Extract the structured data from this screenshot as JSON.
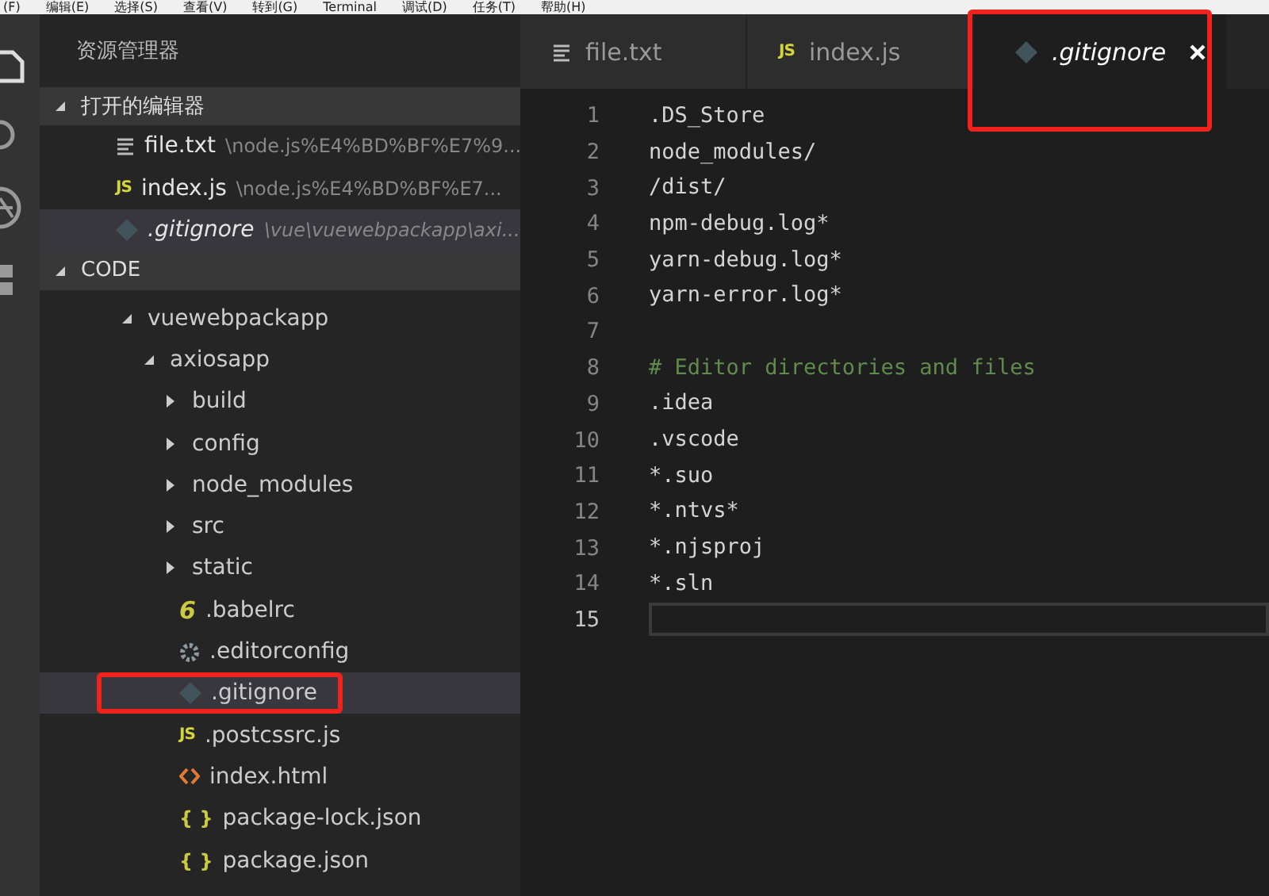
{
  "menu_bar": [
    "(F)",
    "编辑(E)",
    "选择(S)",
    "查看(V)",
    "转到(G)",
    "Terminal",
    "调试(D)",
    "任务(T)",
    "帮助(H)"
  ],
  "sidebar": {
    "title": "资源管理器",
    "open_editors": {
      "label": "打开的编辑器",
      "expanded": true,
      "items": [
        {
          "name": "file.txt",
          "path": "\\node.js%E4%BD%BF%E7%9...",
          "kind": "text",
          "preview": false,
          "selected": false
        },
        {
          "name": "index.js",
          "path": "\\node.js%E4%BD%BF%E7...",
          "kind": "js",
          "icon_text": "JS",
          "preview": false,
          "selected": false
        },
        {
          "name": ".gitignore",
          "path": "\\vue\\vuewebpackapp\\axi...",
          "kind": "git",
          "preview": true,
          "selected": true
        }
      ]
    },
    "folder": {
      "label": "CODE",
      "expanded": true,
      "tree": [
        {
          "name": "vuewebpackapp",
          "kind": "folder",
          "expanded": true,
          "selected": false,
          "annotated": false,
          "children": [
            {
              "name": "axiosapp",
              "kind": "folder",
              "expanded": true,
              "selected": false,
              "annotated": false,
              "children": [
                {
                  "name": "build",
                  "kind": "folder",
                  "expanded": false,
                  "selected": false,
                  "annotated": false
                },
                {
                  "name": "config",
                  "kind": "folder",
                  "expanded": false,
                  "selected": false,
                  "annotated": false
                },
                {
                  "name": "node_modules",
                  "kind": "folder",
                  "expanded": false,
                  "selected": false,
                  "annotated": false
                },
                {
                  "name": "src",
                  "kind": "folder",
                  "expanded": false,
                  "selected": false,
                  "annotated": false
                },
                {
                  "name": "static",
                  "kind": "folder",
                  "expanded": false,
                  "selected": false,
                  "annotated": false
                },
                {
                  "name": ".babelrc",
                  "kind": "babel",
                  "icon_text": "6",
                  "selected": false,
                  "annotated": false
                },
                {
                  "name": ".editorconfig",
                  "kind": "config",
                  "selected": false,
                  "annotated": false
                },
                {
                  "name": ".gitignore",
                  "kind": "git",
                  "selected": true,
                  "annotated": true
                },
                {
                  "name": ".postcssrc.js",
                  "kind": "js",
                  "icon_text": "JS",
                  "selected": false,
                  "annotated": false
                },
                {
                  "name": "index.html",
                  "kind": "html",
                  "selected": false,
                  "annotated": false
                },
                {
                  "name": "package-lock.json",
                  "kind": "json",
                  "icon_text": "{ }",
                  "selected": false,
                  "annotated": false
                },
                {
                  "name": "package.json",
                  "kind": "json",
                  "icon_text": "{ }",
                  "selected": false,
                  "annotated": false
                }
              ]
            }
          ]
        }
      ]
    }
  },
  "tabs": [
    {
      "label": "file.txt",
      "kind": "text",
      "selected": false,
      "preview": false,
      "annotated": false
    },
    {
      "label": "index.js",
      "kind": "js",
      "icon_text": "JS",
      "selected": false,
      "preview": false,
      "annotated": false
    },
    {
      "label": ".gitignore",
      "kind": "git",
      "selected": true,
      "preview": true,
      "annotated": true
    }
  ],
  "editor": {
    "lines": [
      {
        "number": "1",
        "text": ".DS_Store",
        "kind": "plain",
        "current": false
      },
      {
        "number": "2",
        "text": "node_modules/",
        "kind": "plain",
        "current": false
      },
      {
        "number": "3",
        "text": "/dist/",
        "kind": "plain",
        "current": false
      },
      {
        "number": "4",
        "text": "npm-debug.log*",
        "kind": "plain",
        "current": false
      },
      {
        "number": "5",
        "text": "yarn-debug.log*",
        "kind": "plain",
        "current": false
      },
      {
        "number": "6",
        "text": "yarn-error.log*",
        "kind": "plain",
        "current": false
      },
      {
        "number": "7",
        "kind": "plain",
        "current": false
      },
      {
        "number": "8",
        "text": "# Editor directories and files",
        "kind": "comment",
        "current": false
      },
      {
        "number": "9",
        "text": ".idea",
        "kind": "plain",
        "current": false
      },
      {
        "number": "10",
        "text": ".vscode",
        "kind": "plain",
        "current": false
      },
      {
        "number": "11",
        "text": "*.suo",
        "kind": "plain",
        "current": false
      },
      {
        "number": "12",
        "text": "*.ntvs*",
        "kind": "plain",
        "current": false
      },
      {
        "number": "13",
        "text": "*.njsproj",
        "kind": "plain",
        "current": false
      },
      {
        "number": "14",
        "text": "*.sln",
        "kind": "plain",
        "current": false
      },
      {
        "number": "15",
        "kind": "plain",
        "current": true
      }
    ]
  }
}
